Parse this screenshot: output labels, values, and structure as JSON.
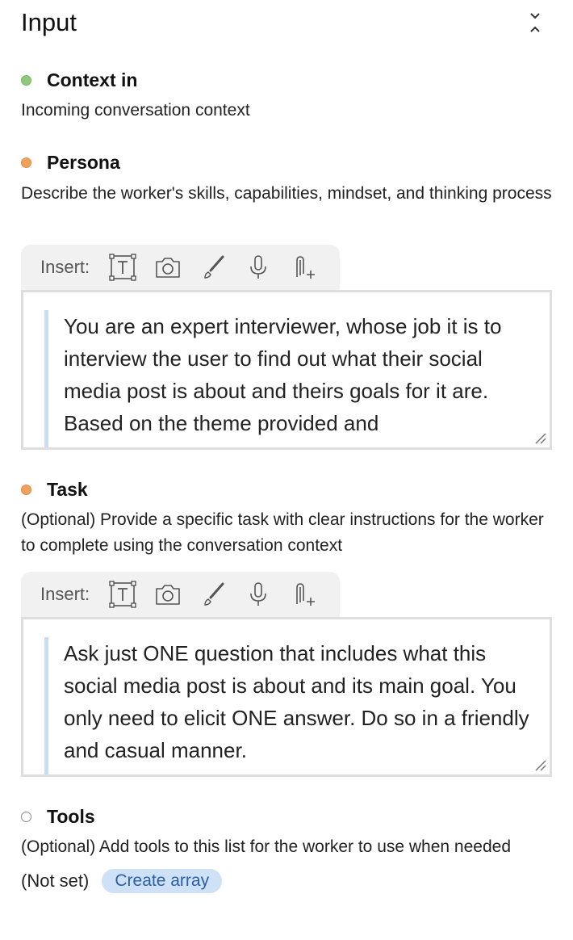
{
  "header": {
    "title": "Input"
  },
  "context_in": {
    "label": "Context in",
    "description": "Incoming conversation context",
    "status_color": "#8cc97a"
  },
  "persona": {
    "label": "Persona",
    "description": "Describe the worker's skills, capabilities, mindset, and thinking process",
    "status_color": "#f0a15a",
    "insert_label": "Insert:",
    "text": "You are an expert interviewer, whose job it is to interview the user to find out what their social media post is about and theirs goals for it are. Based on the theme provided and"
  },
  "task": {
    "label": "Task",
    "description": "(Optional) Provide a specific task with clear instructions for the worker to complete using the conversation context",
    "status_color": "#f0a15a",
    "insert_label": "Insert:",
    "text": "Ask just ONE question that includes what this social media post is about and its main goal. You only need to elicit ONE answer. Do so in a friendly and casual manner."
  },
  "tools": {
    "label": "Tools",
    "description": "(Optional) Add tools to this list for the worker to use when needed",
    "value": "(Not set)",
    "create_button": "Create array"
  },
  "insert_icons": [
    "text-box-icon",
    "camera-icon",
    "brush-icon",
    "microphone-icon",
    "attach-icon"
  ],
  "accent_color": "#cfe1f7"
}
